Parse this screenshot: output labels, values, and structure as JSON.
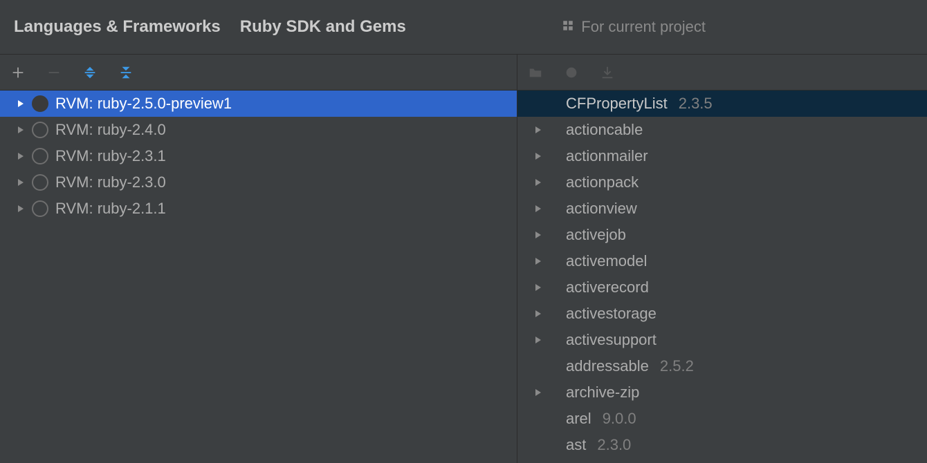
{
  "breadcrumb": {
    "section": "Languages & Frameworks",
    "page": "Ruby SDK and Gems"
  },
  "scope_label": "For current project",
  "sdks": [
    {
      "name": "RVM: ruby-2.5.0-preview1",
      "selected": true
    },
    {
      "name": "RVM: ruby-2.4.0",
      "selected": false
    },
    {
      "name": "RVM: ruby-2.3.1",
      "selected": false
    },
    {
      "name": "RVM: ruby-2.3.0",
      "selected": false
    },
    {
      "name": "RVM: ruby-2.1.1",
      "selected": false
    }
  ],
  "gems": [
    {
      "name": "CFPropertyList",
      "version": "2.3.5",
      "expandable": false,
      "selected": true
    },
    {
      "name": "actioncable",
      "version": "",
      "expandable": true,
      "selected": false
    },
    {
      "name": "actionmailer",
      "version": "",
      "expandable": true,
      "selected": false
    },
    {
      "name": "actionpack",
      "version": "",
      "expandable": true,
      "selected": false
    },
    {
      "name": "actionview",
      "version": "",
      "expandable": true,
      "selected": false
    },
    {
      "name": "activejob",
      "version": "",
      "expandable": true,
      "selected": false
    },
    {
      "name": "activemodel",
      "version": "",
      "expandable": true,
      "selected": false
    },
    {
      "name": "activerecord",
      "version": "",
      "expandable": true,
      "selected": false
    },
    {
      "name": "activestorage",
      "version": "",
      "expandable": true,
      "selected": false
    },
    {
      "name": "activesupport",
      "version": "",
      "expandable": true,
      "selected": false
    },
    {
      "name": "addressable",
      "version": "2.5.2",
      "expandable": false,
      "selected": false
    },
    {
      "name": "archive-zip",
      "version": "",
      "expandable": true,
      "selected": false
    },
    {
      "name": "arel",
      "version": "9.0.0",
      "expandable": false,
      "selected": false
    },
    {
      "name": "ast",
      "version": "2.3.0",
      "expandable": false,
      "selected": false
    }
  ]
}
